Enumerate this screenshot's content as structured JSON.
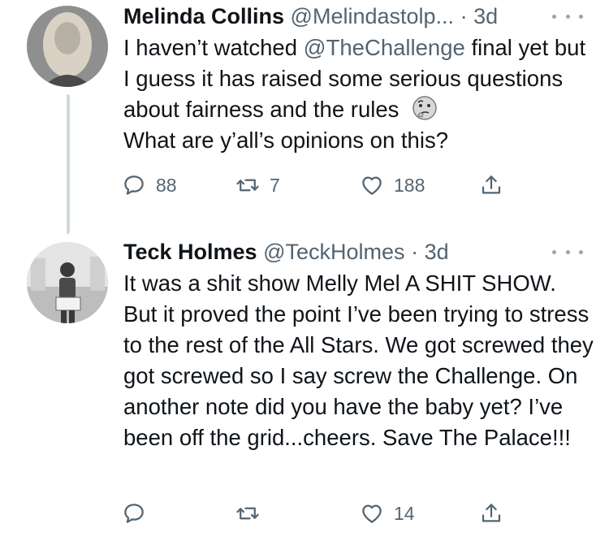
{
  "tweets": [
    {
      "name": "Melinda Collins",
      "handle": "@Melindastolp...",
      "dot": "·",
      "time": "3d",
      "text_before": "I haven’t watched ",
      "mention": "@TheChallenge",
      "text_after": " final yet but I guess it has raised some serious questions about fairness and the rules",
      "text_line2": "What are y’all’s opinions on this?",
      "emoji": "thinking-face",
      "replies": "88",
      "retweets": "7",
      "likes": "188"
    },
    {
      "name": "Teck Holmes",
      "handle": "@TeckHolmes",
      "dot": "·",
      "time": "3d",
      "text": "It was a shit show Melly Mel A SHIT SHOW. But it proved the point I’ve been trying to stress to the rest of the All Stars. We got screwed they got screwed so I say screw the Challenge. On another note did you have the baby yet? I’ve been off the grid...cheers. Save The Palace!!!",
      "replies": "",
      "retweets": "",
      "likes": "14"
    }
  ],
  "icons": {
    "reply": "reply-icon",
    "retweet": "retweet-icon",
    "like": "heart-icon",
    "share": "share-icon",
    "more": "more-icon"
  },
  "colors": {
    "text": "#0f1419",
    "secondary": "#536471",
    "thread_line": "#cfd9de"
  }
}
